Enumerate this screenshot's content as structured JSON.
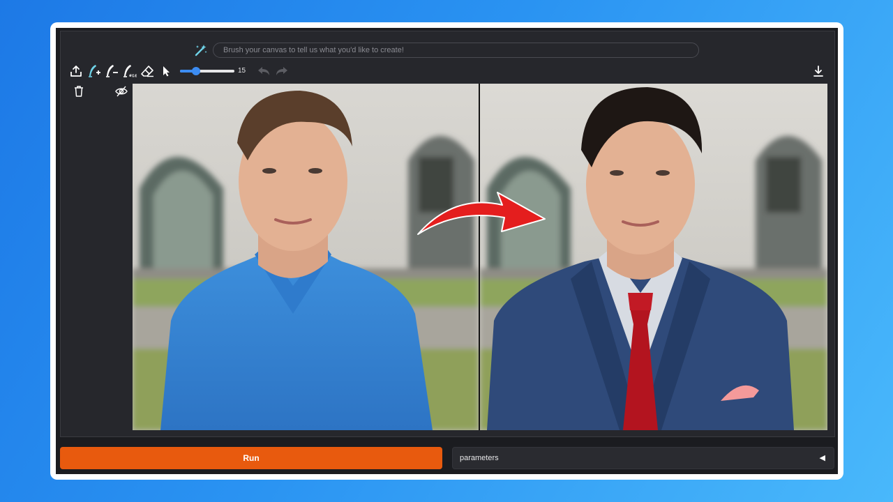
{
  "toolbar": {
    "prompt_placeholder": "Brush your canvas to tell us what you'd like to create!",
    "brush_size": 15,
    "brush_size_min": 0,
    "brush_size_max": 50,
    "tools": [
      "wand-icon",
      "upload-icon",
      "brush-add-icon",
      "brush-remove-icon",
      "brush-large-icon",
      "eraser-icon",
      "pointer-icon",
      "undo-icon",
      "redo-icon",
      "download-icon",
      "trash-icon",
      "visibility-off-icon"
    ]
  },
  "footer": {
    "run_label": "Run",
    "parameters_label": "parameters",
    "parameters_arrow": "◀"
  },
  "colors": {
    "accent": "#3c8cf2",
    "run_button": "#e85a0e",
    "panel_bg": "#26272c",
    "page_bg": "#2a93f2",
    "arrow": "#e41e1e"
  }
}
